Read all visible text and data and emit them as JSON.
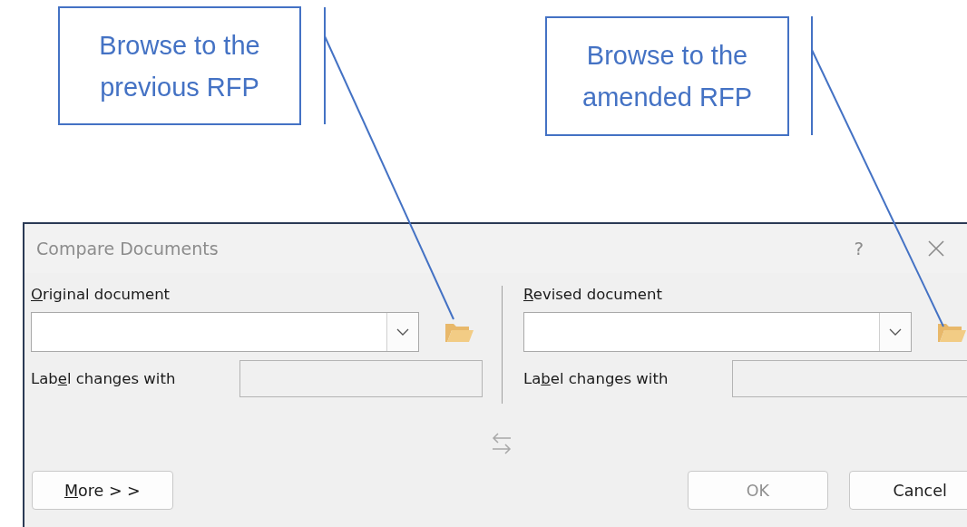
{
  "callouts": [
    {
      "text": "Browse to the previous RFP"
    },
    {
      "text": "Browse to the amended RFP"
    }
  ],
  "window": {
    "title": "Compare Documents",
    "help": "?"
  },
  "original": {
    "label": {
      "key": "O",
      "after": "riginal document"
    },
    "label_changes": {
      "before": "Lab",
      "key": "e",
      "after": "l changes with"
    }
  },
  "revised": {
    "label": {
      "key": "R",
      "after": "evised document"
    },
    "label_changes": {
      "before": "La",
      "key": "b",
      "after": "el changes with"
    }
  },
  "buttons": [
    {
      "kind": "more",
      "key": "M",
      "after": "ore > >",
      "disabled": false
    },
    {
      "kind": "ok",
      "after": "OK",
      "disabled": true
    },
    {
      "kind": "cancel",
      "after": "Cancel",
      "disabled": false
    }
  ]
}
